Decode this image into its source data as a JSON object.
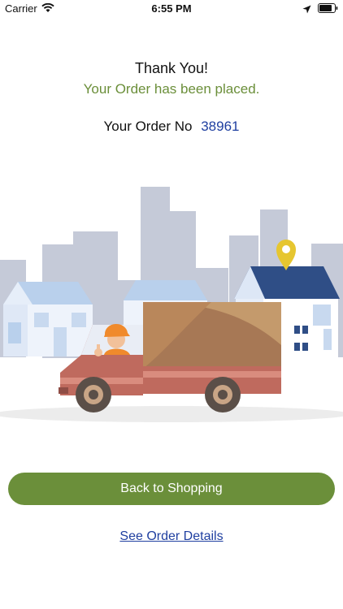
{
  "status_bar": {
    "carrier": "Carrier",
    "time": "6:55 PM",
    "wifi_icon": "wifi-icon",
    "location_icon": "location-arrow-icon",
    "battery_icon": "battery-icon"
  },
  "confirmation": {
    "title": "Thank You!",
    "subtitle": "Your Order has been placed.",
    "order_label": "Your Order No",
    "order_number": "38961"
  },
  "illustration": {
    "description_icon": "delivery-truck-illustration"
  },
  "actions": {
    "back_to_shopping": "Back to Shopping",
    "see_order_details": "See Order Details"
  },
  "colors": {
    "accent_green": "#6b8f3a",
    "link_blue": "#1f3fa0"
  }
}
